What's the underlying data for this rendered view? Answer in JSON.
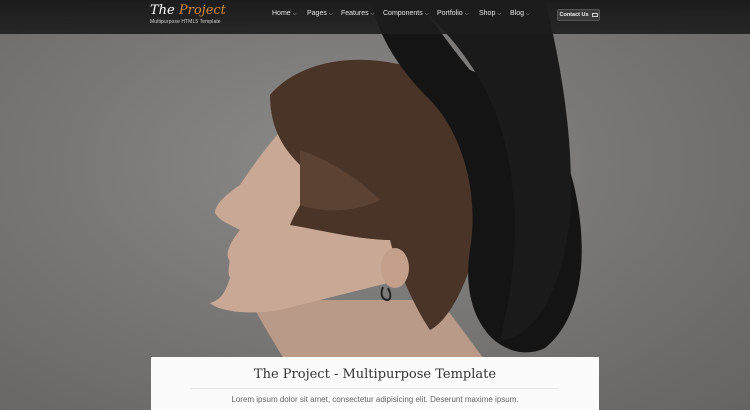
{
  "brand": {
    "name_part1": "The ",
    "name_part2": "Project",
    "tagline": "Multipurpose HTML5 Template",
    "accent_color": "#d08a37"
  },
  "nav": {
    "items": [
      {
        "label": "Home"
      },
      {
        "label": "Pages"
      },
      {
        "label": "Features"
      },
      {
        "label": "Components"
      },
      {
        "label": "Portfolio"
      },
      {
        "label": "Shop"
      },
      {
        "label": "Blog"
      }
    ],
    "chevron_icon": "chevron-down-icon",
    "contact_label": "Contact Us",
    "contact_icon": "envelope-icon"
  },
  "hero": {
    "image": "portrait-profile-black-hat",
    "caption_title": "The Project - Multipurpose Template",
    "caption_text": "Lorem ipsum dolor sit amet, consectetur adipisicing elit. Deserunt maxime ipsum."
  }
}
